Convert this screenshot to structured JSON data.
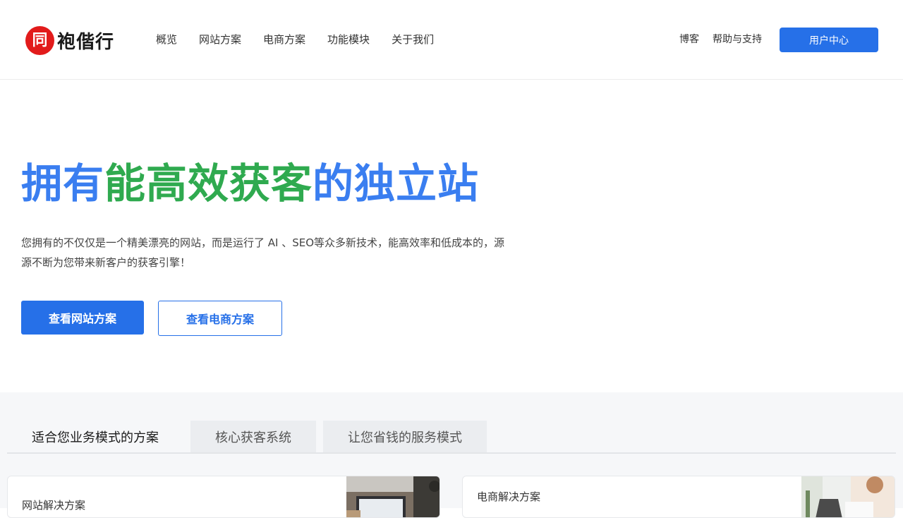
{
  "header": {
    "logo_seal": "同",
    "logo_text": "袍偕行",
    "nav": [
      "概览",
      "网站方案",
      "电商方案",
      "功能模块",
      "关于我们"
    ],
    "blog": "博客",
    "help": "帮助与支持",
    "user_center": "用户中心"
  },
  "hero": {
    "title_part1": "拥有",
    "title_part2": "能高效获客",
    "title_part3": "的独立站",
    "desc_line1": "您拥有的不仅仅是一个精美漂亮的网站，而是运行了 AI 、SEO等众多新技术，能高效率和低成本的，源",
    "desc_line2": "源不断为您带来新客户的获客引擎！",
    "btn_website": "查看网站方案",
    "btn_ecommerce": "查看电商方案"
  },
  "tabs": [
    "适合您业务模式的方案",
    "核心获客系统",
    "让您省钱的服务模式"
  ],
  "cards": {
    "website": "网站解决方案",
    "ecommerce": "电商解决方案"
  },
  "colors": {
    "primary": "#2670e8",
    "title_blue": "#3a7ef0",
    "title_green": "#2faa4f",
    "logo_red": "#e21b1b"
  }
}
